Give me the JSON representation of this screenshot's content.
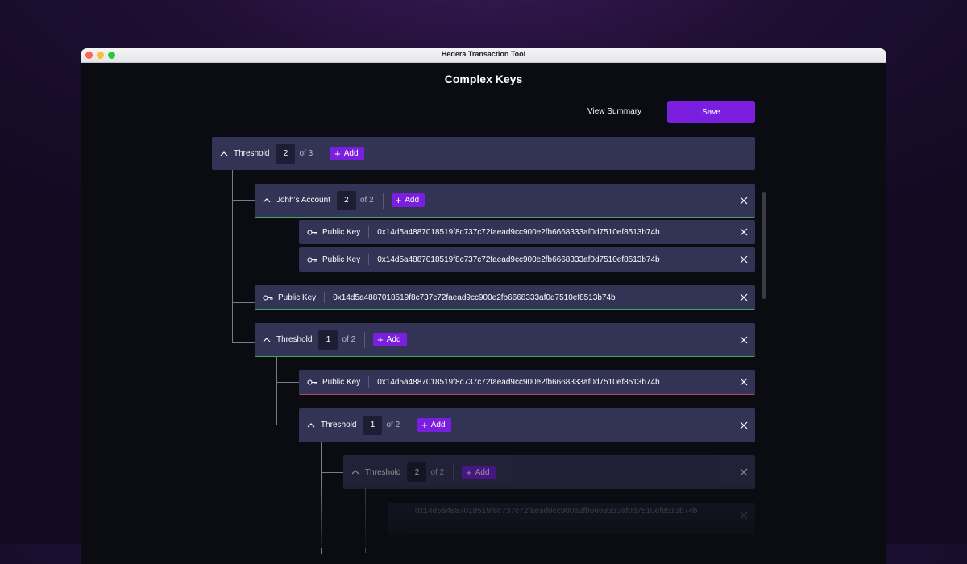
{
  "window": {
    "title": "Hedera Transaction Tool"
  },
  "page": {
    "title": "Complex Keys"
  },
  "toolbar": {
    "summary_label": "View Summary",
    "save_label": "Save"
  },
  "common": {
    "add_label": "Add",
    "public_key_label": "Public Key"
  },
  "tree": {
    "root": {
      "label": "Threshold",
      "threshold": "2",
      "of": "of 3"
    },
    "johns_account": {
      "label": "Johh's Account",
      "threshold": "2",
      "of": "of 2"
    },
    "key_1": "0x14d5a4887018519f8c737c72faead9cc900e2fb6668333af0d7510ef8513b74b",
    "key_2": "0x14d5a4887018519f8c737c72faead9cc900e2fb6668333af0d7510ef8513b74b",
    "key_3": "0x14d5a4887018519f8c737c72faead9cc900e2fb6668333af0d7510ef8513b74b",
    "threshold_a": {
      "label": "Threshold",
      "threshold": "1",
      "of": "of 2"
    },
    "key_4": "0x14d5a4887018519f8c737c72faead9cc900e2fb6668333af0d7510ef8513b74b",
    "threshold_b": {
      "label": "Threshold",
      "threshold": "1",
      "of": "of 2"
    },
    "threshold_c": {
      "label": "Threshold",
      "threshold": "2",
      "of": "of 2"
    },
    "key_5": "0x14d5a4887018519f8c737c72faead9cc900e2fb6668333af0d7510ef8513b74b"
  },
  "colors": {
    "accent": "#7a1fe0",
    "row_bg": "#333356",
    "success_line": "#3fa768",
    "error_line": "#b24a58"
  }
}
